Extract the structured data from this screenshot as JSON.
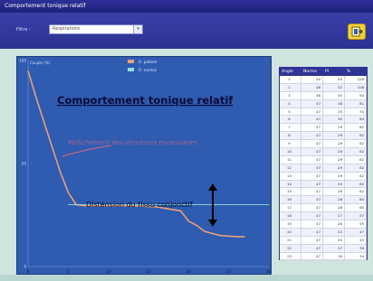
{
  "window": {
    "title": "Comportement tonique relatif"
  },
  "toolbar": {
    "filter_label": "Filtre :",
    "selected_option": "Respiratoire",
    "exit_icon": "exit-door-icon"
  },
  "chart": {
    "title": "Comportement tonique relatif",
    "annotation": "Distension du tissu conjonctif",
    "faded_annotation": "Relâchement des structures musculaires",
    "y_unit": "Couple (%)",
    "legend": [
      "Fr. patient",
      "Fr. normal"
    ],
    "colors": {
      "series_patient": "#e8a07a",
      "series_normal": "#8fe0d8",
      "background": "#2f5bb0"
    }
  },
  "chart_data": {
    "type": "line",
    "title": "Comportement tonique relatif",
    "xlabel": "",
    "ylabel": "Couple (%)",
    "xlim": [
      0,
      30
    ],
    "ylim": [
      0,
      100
    ],
    "x_ticks": [
      "0",
      "5",
      "10",
      "15",
      "20",
      "25",
      "30"
    ],
    "y_ticks": [
      "0",
      "50",
      "100"
    ],
    "series": [
      {
        "name": "Fr. patient",
        "x": [
          0,
          1,
          2,
          3,
          4,
          5,
          6,
          7,
          8,
          10,
          13,
          16,
          19,
          20,
          21,
          22,
          24,
          26,
          27
        ],
        "y": [
          95,
          82,
          70,
          58,
          46,
          36,
          30,
          29.5,
          29.5,
          29.5,
          29.5,
          29,
          27,
          22,
          20,
          17,
          15,
          14.5,
          14.5
        ]
      },
      {
        "name": "Fr. normal",
        "x": [
          5,
          10,
          15,
          20,
          25,
          30
        ],
        "y": [
          30,
          30,
          30,
          30,
          30,
          30
        ]
      }
    ]
  },
  "table": {
    "headers": [
      "Angle",
      "Normo",
      "Pl",
      "%"
    ],
    "subheaders": [
      "",
      "",
      "",
      ""
    ],
    "rows": [
      [
        "1",
        "50",
        "63",
        "126"
      ],
      [
        "2",
        "48",
        "52",
        "108"
      ],
      [
        "3",
        "48",
        "45",
        "94"
      ],
      [
        "4",
        "47",
        "38",
        "81"
      ],
      [
        "5",
        "47",
        "33",
        "70"
      ],
      [
        "6",
        "47",
        "30",
        "64"
      ],
      [
        "7",
        "47",
        "29",
        "62"
      ],
      [
        "8",
        "47",
        "29",
        "62"
      ],
      [
        "9",
        "47",
        "29",
        "62"
      ],
      [
        "10",
        "47",
        "29",
        "62"
      ],
      [
        "11",
        "47",
        "29",
        "62"
      ],
      [
        "12",
        "47",
        "29",
        "62"
      ],
      [
        "13",
        "47",
        "29",
        "62"
      ],
      [
        "14",
        "47",
        "29",
        "62"
      ],
      [
        "15",
        "47",
        "29",
        "62"
      ],
      [
        "16",
        "47",
        "28",
        "60"
      ],
      [
        "17",
        "47",
        "28",
        "60"
      ],
      [
        "18",
        "47",
        "27",
        "57"
      ],
      [
        "19",
        "47",
        "26",
        "55"
      ],
      [
        "20",
        "47",
        "22",
        "47"
      ],
      [
        "21",
        "47",
        "20",
        "43"
      ],
      [
        "22",
        "47",
        "17",
        "36"
      ],
      [
        "23",
        "47",
        "16",
        "34"
      ]
    ]
  }
}
